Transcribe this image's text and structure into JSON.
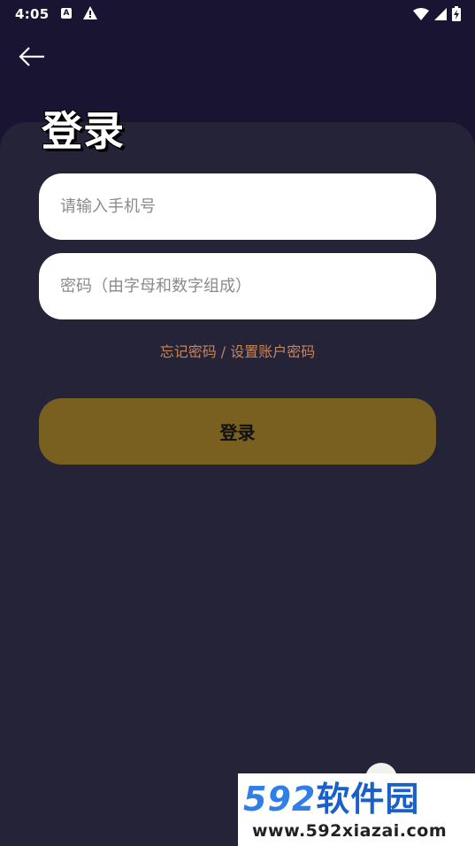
{
  "status_bar": {
    "time": "4:05",
    "icons": [
      "font-a-icon",
      "warning-icon",
      "wifi-icon",
      "cell-signal-icon",
      "battery-charging-icon"
    ]
  },
  "nav": {
    "back_icon": "arrow-left-icon"
  },
  "login": {
    "title": "登录",
    "phone_placeholder": "请输入手机号",
    "password_placeholder": "密码（由字母和数字组成）",
    "forgot_link": "忘记密码 / 设置账户密码",
    "submit_label": "登录"
  },
  "watermark": {
    "brand_number": "592",
    "brand_text": "软件园",
    "url": "www.592xiazai.com"
  },
  "colors": {
    "background": "#1a1433",
    "card": "#242338",
    "button": "#796021",
    "link": "#c8845a",
    "brand_blue": "#2f7fe6"
  }
}
